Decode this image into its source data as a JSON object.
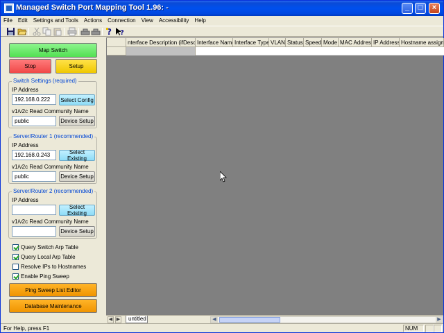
{
  "window": {
    "title": "Managed Switch Port Mapping Tool 1.96: -",
    "controls": {
      "minimize": "_",
      "maximize": "□",
      "close": "×"
    }
  },
  "menu": [
    "File",
    "Edit",
    "Settings and Tools",
    "Actions",
    "Connection",
    "View",
    "Accessibility",
    "Help"
  ],
  "toolbar": {
    "icons": [
      "save-icon",
      "open-folder-icon",
      "cut-icon",
      "copy-icon",
      "paste-icon",
      "print-icon",
      "switch-icon",
      "switch-icon-2",
      "about-icon",
      "context-help-icon"
    ]
  },
  "left": {
    "map_switch": "Map Switch",
    "stop": "Stop",
    "setup": "Setup",
    "switch_settings": {
      "title": "Switch Settings (required)",
      "ip_label": "IP Address",
      "ip_value": "192.168.0.222",
      "select_config": "Select Config",
      "community_label": "v1/v2c Read Community Name",
      "community_value": "public",
      "device_setup": "Device Setup"
    },
    "router1": {
      "title": "Server/Router 1 (recommended)",
      "ip_label": "IP Address",
      "ip_value": "192.168.0.243",
      "select_existing": "Select Existing",
      "community_label": "v1/v2c Read Community Name",
      "community_value": "public",
      "device_setup": "Device Setup"
    },
    "router2": {
      "title": "Server/Router 2 (recommended)",
      "ip_label": "IP Address",
      "ip_value": "",
      "select_existing": "Select Existing",
      "community_label": "v1/v2c Read Community Name",
      "community_value": "",
      "device_setup": "Device Setup"
    },
    "checkboxes": [
      {
        "label": "Query Switch Arp Table",
        "checked": true
      },
      {
        "label": "Query Local Arp Table",
        "checked": true
      },
      {
        "label": "Resolve IPs to Hostnames",
        "checked": false
      },
      {
        "label": "Enable Ping Sweep",
        "checked": true
      }
    ],
    "ping_sweep": "Ping Sweep List Editor",
    "database": "Database Maintenance"
  },
  "grid": {
    "columns": [
      "nterface Description (ifDesc ▽",
      "Interface Name",
      "Interface Type",
      "VLAN",
      "Status",
      "Speed",
      "Mode",
      "MAC Address",
      "IP Address",
      "Hostname assigned"
    ]
  },
  "tabs": {
    "sheet": "untitled"
  },
  "status": {
    "message": "For Help, press F1",
    "num": "NUM"
  },
  "colors": {
    "title_bar": "#0050ee",
    "map_switch": "#52e052",
    "stop": "#f04848",
    "setup": "#f0c800",
    "select_button": "#8edcf6",
    "orange_button": "#f09400",
    "group_title": "#0046d5"
  }
}
